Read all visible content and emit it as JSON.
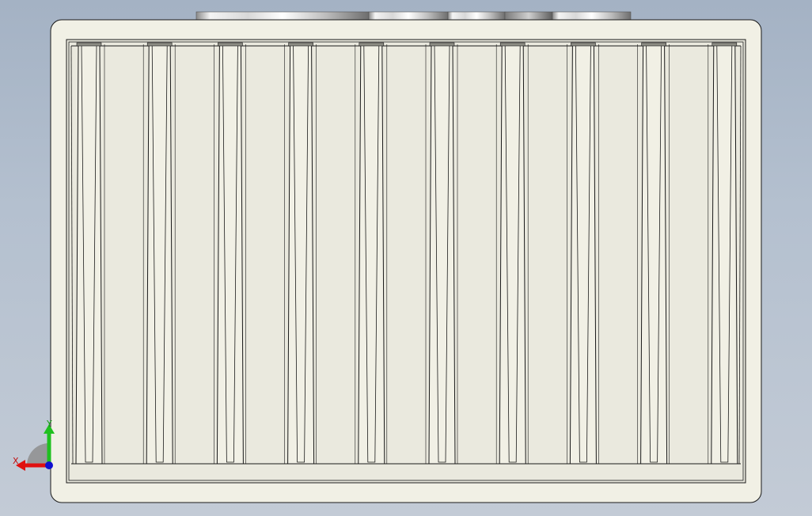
{
  "viewport": {
    "background_top": "#a4b2c4",
    "background_bottom": "#c3cbd6"
  },
  "model": {
    "view": "front",
    "body_color": "#f1f0e5",
    "edge_color": "#000000",
    "rib_count": 10,
    "top_feature": "shaded-bar-strip"
  },
  "triad": {
    "x_label": "X",
    "y_label": "Y",
    "x_color": "#e01010",
    "y_color": "#20c020",
    "z_color": "#1010d0"
  }
}
